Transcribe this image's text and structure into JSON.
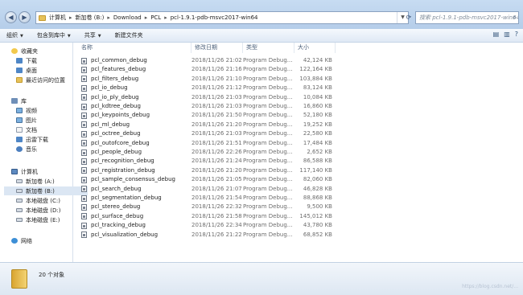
{
  "address": {
    "crumbs": [
      "计算机",
      "新加卷 (B:)",
      "Download",
      "PCL",
      "pcl-1.9.1-pdb-msvc2017-win64"
    ],
    "search_placeholder": "搜索 pcl-1.9.1-pdb-msvc2017-win64"
  },
  "toolbar": {
    "organize": "组织",
    "include_library": "包含到库中",
    "share": "共享",
    "new_folder": "新建文件夹"
  },
  "sidebar": {
    "favorites": {
      "label": "收藏夹",
      "items": [
        "下载",
        "桌面",
        "最近访问的位置"
      ]
    },
    "libraries": {
      "label": "库",
      "items": [
        "视频",
        "图片",
        "文档",
        "迅雷下载",
        "音乐"
      ]
    },
    "computer": {
      "label": "计算机",
      "items": [
        "新加卷 (A:)",
        "新加卷 (B:)",
        "本地磁盘 (C:)",
        "本地磁盘 (D:)",
        "本地磁盘 (E:)"
      ]
    },
    "network": {
      "label": "网络"
    }
  },
  "columns": {
    "name": "名称",
    "date": "修改日期",
    "type": "类型",
    "size": "大小"
  },
  "files": [
    {
      "name": "pcl_common_debug",
      "date": "2018/11/26 21:02",
      "type": "Program Debug...",
      "size": "42,124 KB"
    },
    {
      "name": "pcl_features_debug",
      "date": "2018/11/26 21:16",
      "type": "Program Debug...",
      "size": "122,164 KB"
    },
    {
      "name": "pcl_filters_debug",
      "date": "2018/11/26 21:10",
      "type": "Program Debug...",
      "size": "103,884 KB"
    },
    {
      "name": "pcl_io_debug",
      "date": "2018/11/26 21:12",
      "type": "Program Debug...",
      "size": "83,124 KB"
    },
    {
      "name": "pcl_io_ply_debug",
      "date": "2018/11/26 21:03",
      "type": "Program Debug...",
      "size": "10,084 KB"
    },
    {
      "name": "pcl_kdtree_debug",
      "date": "2018/11/26 21:03",
      "type": "Program Debug...",
      "size": "16,860 KB"
    },
    {
      "name": "pcl_keypoints_debug",
      "date": "2018/11/26 21:50",
      "type": "Program Debug...",
      "size": "52,180 KB"
    },
    {
      "name": "pcl_ml_debug",
      "date": "2018/11/26 21:20",
      "type": "Program Debug...",
      "size": "19,252 KB"
    },
    {
      "name": "pcl_octree_debug",
      "date": "2018/11/26 21:03",
      "type": "Program Debug...",
      "size": "22,580 KB"
    },
    {
      "name": "pcl_outofcore_debug",
      "date": "2018/11/26 21:51",
      "type": "Program Debug...",
      "size": "17,484 KB"
    },
    {
      "name": "pcl_people_debug",
      "date": "2018/11/26 22:26",
      "type": "Program Debug...",
      "size": "2,652 KB"
    },
    {
      "name": "pcl_recognition_debug",
      "date": "2018/11/26 21:24",
      "type": "Program Debug...",
      "size": "86,588 KB"
    },
    {
      "name": "pcl_registration_debug",
      "date": "2018/11/26 21:20",
      "type": "Program Debug...",
      "size": "117,140 KB"
    },
    {
      "name": "pcl_sample_consensus_debug",
      "date": "2018/11/26 21:05",
      "type": "Program Debug...",
      "size": "82,060 KB"
    },
    {
      "name": "pcl_search_debug",
      "date": "2018/11/26 21:07",
      "type": "Program Debug...",
      "size": "46,828 KB"
    },
    {
      "name": "pcl_segmentation_debug",
      "date": "2018/11/26 21:54",
      "type": "Program Debug...",
      "size": "88,868 KB"
    },
    {
      "name": "pcl_stereo_debug",
      "date": "2018/11/26 22:32",
      "type": "Program Debug...",
      "size": "9,500 KB"
    },
    {
      "name": "pcl_surface_debug",
      "date": "2018/11/26 21:58",
      "type": "Program Debug...",
      "size": "145,012 KB"
    },
    {
      "name": "pcl_tracking_debug",
      "date": "2018/11/26 22:34",
      "type": "Program Debug...",
      "size": "43,780 KB"
    },
    {
      "name": "pcl_visualization_debug",
      "date": "2018/11/26 21:22",
      "type": "Program Debug...",
      "size": "68,852 KB"
    }
  ],
  "status": {
    "count": "20 个对象"
  },
  "watermark": "https://blog.csdn.net/..."
}
